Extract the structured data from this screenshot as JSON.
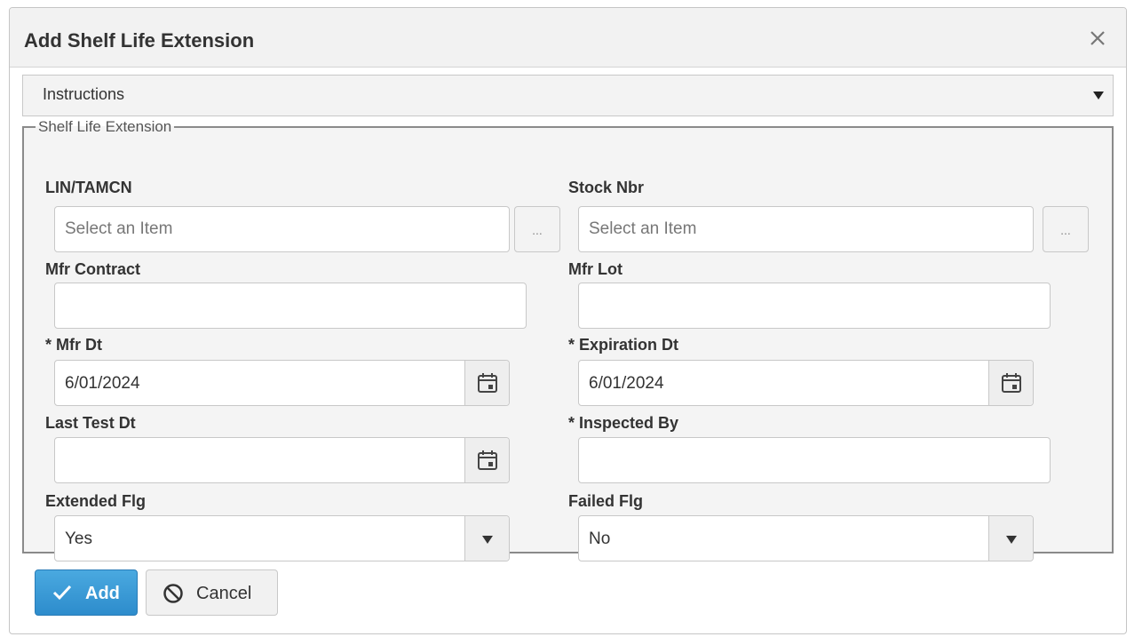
{
  "dialog": {
    "title": "Add Shelf Life Extension",
    "close_icon": "close-x-icon"
  },
  "instructions": {
    "label": "Instructions",
    "toggle_icon": "caret-down-icon"
  },
  "form": {
    "legend": "Shelf Life Extension",
    "lin_tamcn": {
      "label": "LIN/TAMCN",
      "placeholder": "Select an Item",
      "value": "",
      "button_label": "..."
    },
    "stock_nbr": {
      "label": "Stock Nbr",
      "placeholder": "Select an Item",
      "value": "",
      "button_label": "..."
    },
    "mfr_contract": {
      "label": "Mfr Contract",
      "value": ""
    },
    "mfr_lot": {
      "label": "Mfr Lot",
      "value": ""
    },
    "mfr_dt": {
      "required_mark": "*",
      "label": "Mfr Dt",
      "value": "6/01/2024",
      "icon": "calendar-icon"
    },
    "expiration_dt": {
      "required_mark": "*",
      "label": "Expiration Dt",
      "value": "6/01/2024",
      "icon": "calendar-icon"
    },
    "last_test_dt": {
      "label": "Last Test Dt",
      "value": "",
      "icon": "calendar-icon"
    },
    "inspected_by": {
      "required_mark": "*",
      "label": "Inspected By",
      "value": ""
    },
    "extended_flg": {
      "label": "Extended Flg",
      "value": "Yes"
    },
    "failed_flg": {
      "label": "Failed Flg",
      "value": "No"
    }
  },
  "actions": {
    "add_label": "Add",
    "add_icon": "checkmark-icon",
    "cancel_label": "Cancel",
    "cancel_icon": "prohibited-circle-icon"
  },
  "colors": {
    "primary_button": "#2d8ccc",
    "titlebar_bg": "#f2f2f2",
    "fieldset_bg": "#f4f4f4"
  }
}
